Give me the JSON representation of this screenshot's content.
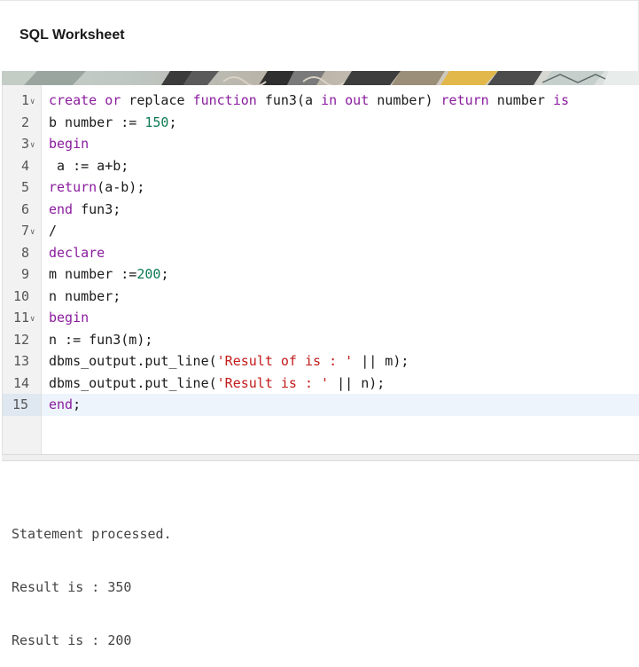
{
  "header": {
    "title": "SQL Worksheet"
  },
  "editor": {
    "lines": [
      {
        "num": "1",
        "fold": true,
        "tokens": [
          {
            "t": "create",
            "c": "kw"
          },
          {
            "t": " "
          },
          {
            "t": "or",
            "c": "kw"
          },
          {
            "t": " replace "
          },
          {
            "t": "function",
            "c": "kw"
          },
          {
            "t": " fun3(a "
          },
          {
            "t": "in",
            "c": "kw"
          },
          {
            "t": " "
          },
          {
            "t": "out",
            "c": "kw"
          },
          {
            "t": " number) "
          },
          {
            "t": "return",
            "c": "kw"
          },
          {
            "t": " number "
          },
          {
            "t": "is",
            "c": "kw"
          }
        ]
      },
      {
        "num": "2",
        "fold": false,
        "tokens": [
          {
            "t": "b number := "
          },
          {
            "t": "150",
            "c": "num"
          },
          {
            "t": ";"
          }
        ]
      },
      {
        "num": "3",
        "fold": true,
        "tokens": [
          {
            "t": "begin",
            "c": "kw"
          }
        ]
      },
      {
        "num": "4",
        "fold": false,
        "tokens": [
          {
            "t": " a := a+b;"
          }
        ]
      },
      {
        "num": "5",
        "fold": false,
        "tokens": [
          {
            "t": "return",
            "c": "kw"
          },
          {
            "t": "(a-b);"
          }
        ]
      },
      {
        "num": "6",
        "fold": false,
        "tokens": [
          {
            "t": "end",
            "c": "kw"
          },
          {
            "t": " fun3;"
          }
        ]
      },
      {
        "num": "7",
        "fold": true,
        "tokens": [
          {
            "t": "/"
          }
        ]
      },
      {
        "num": "8",
        "fold": false,
        "tokens": [
          {
            "t": "declare",
            "c": "kw"
          }
        ]
      },
      {
        "num": "9",
        "fold": false,
        "tokens": [
          {
            "t": "m number :="
          },
          {
            "t": "200",
            "c": "num"
          },
          {
            "t": ";"
          }
        ]
      },
      {
        "num": "10",
        "fold": false,
        "tokens": [
          {
            "t": "n number;"
          }
        ]
      },
      {
        "num": "11",
        "fold": true,
        "tokens": [
          {
            "t": "begin",
            "c": "kw"
          }
        ]
      },
      {
        "num": "12",
        "fold": false,
        "tokens": [
          {
            "t": "n := fun3(m);"
          }
        ]
      },
      {
        "num": "13",
        "fold": false,
        "tokens": [
          {
            "t": "dbms_output.put_line("
          },
          {
            "t": "'Result of is : '",
            "c": "str"
          },
          {
            "t": " || m);"
          }
        ]
      },
      {
        "num": "14",
        "fold": false,
        "tokens": [
          {
            "t": "dbms_output.put_line("
          },
          {
            "t": "'Result is : '",
            "c": "str"
          },
          {
            "t": " || n);"
          }
        ]
      },
      {
        "num": "15",
        "fold": false,
        "active": true,
        "tokens": [
          {
            "t": "end",
            "c": "kw"
          },
          {
            "t": ";"
          }
        ]
      }
    ]
  },
  "output": {
    "lines": [
      "Statement processed.",
      "Result is : 350",
      "Result is : 200"
    ]
  },
  "icons": {
    "fold": "chevron-down-icon"
  },
  "colors": {
    "keyword": "#8a1c9e",
    "number": "#0b7a52",
    "string": "#c21a1a",
    "active_line": "#eef4fb"
  }
}
